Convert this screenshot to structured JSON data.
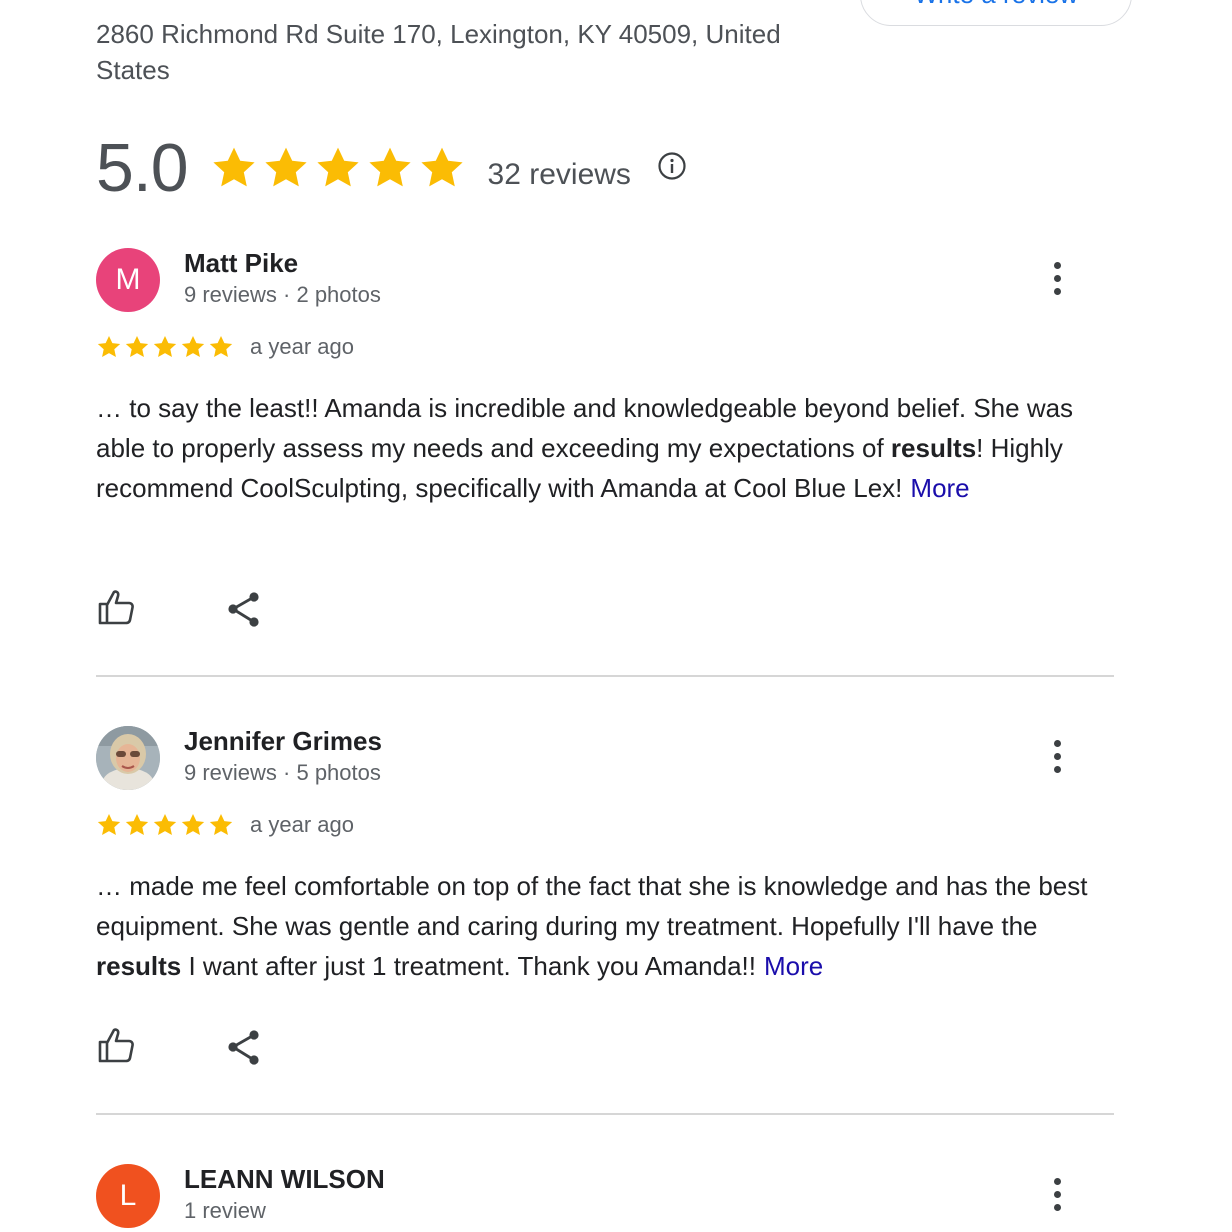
{
  "header": {
    "address": "2860 Richmond Rd Suite 170, Lexington, KY 40509, United States",
    "write_review_label": "Write a review"
  },
  "summary": {
    "rating": "5.0",
    "stars": 5,
    "review_count": "32 reviews",
    "info_icon": "info-icon",
    "star_color": "#fbbc04"
  },
  "reviews": [
    {
      "name": "Matt Pike",
      "meta": "9 reviews · 2 photos",
      "avatar_letter": "M",
      "avatar_color": "#e8437a",
      "stars": 5,
      "date": "a year ago",
      "text_before": "… to say the least!! Amanda is incredible and knowledgeable beyond belief. She was able to properly assess my needs and exceeding my expectations of ",
      "text_bold": "results",
      "text_after": "! Highly recommend CoolSculpting, specifically with Amanda at Cool Blue Lex!",
      "more_label": "More"
    },
    {
      "name": "Jennifer Grimes",
      "meta": "9 reviews · 5 photos",
      "avatar_letter": "",
      "avatar_color": "#b8c2c8",
      "stars": 5,
      "date": "a year ago",
      "text_before": "… made me feel comfortable on top of the fact that she is knowledge and has the best equipment. She was gentle and caring during my treatment. Hopefully I'll have the ",
      "text_bold": "results",
      "text_after": " I want after just 1 treatment. Thank you Amanda!!",
      "more_label": "More"
    },
    {
      "name": "LEANN WILSON",
      "meta": "1 review",
      "avatar_letter": "L",
      "avatar_color": "#f0511f"
    }
  ],
  "icons": {
    "like": "thumbs-up-icon",
    "share": "share-icon",
    "menu": "more-vert-icon"
  }
}
